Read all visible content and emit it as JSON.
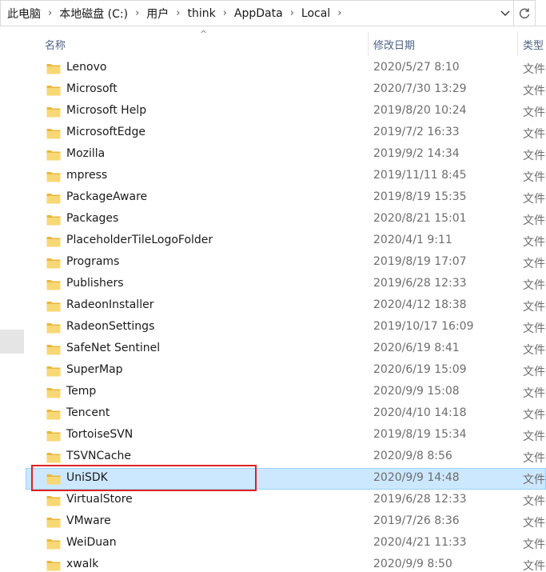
{
  "address_bar": {
    "crumbs": [
      "此电脑",
      "本地磁盘 (C:)",
      "用户",
      "think",
      "AppData",
      "Local"
    ],
    "separator": "›",
    "dropdown_icon": "chevron-down-icon",
    "refresh_icon": "refresh-icon"
  },
  "columns": {
    "name": "名称",
    "date_modified": "修改日期",
    "type": "类型",
    "sort_indicator": "^"
  },
  "rows": [
    {
      "name": "Lenovo",
      "date": "2020/5/27 8:10",
      "type": "文件"
    },
    {
      "name": "Microsoft",
      "date": "2020/7/30 13:29",
      "type": "文件"
    },
    {
      "name": "Microsoft Help",
      "date": "2019/8/20 10:24",
      "type": "文件"
    },
    {
      "name": "MicrosoftEdge",
      "date": "2019/7/2 16:33",
      "type": "文件"
    },
    {
      "name": "Mozilla",
      "date": "2019/9/2 14:34",
      "type": "文件"
    },
    {
      "name": "mpress",
      "date": "2019/11/11 8:45",
      "type": "文件"
    },
    {
      "name": "PackageAware",
      "date": "2019/8/19 15:35",
      "type": "文件"
    },
    {
      "name": "Packages",
      "date": "2020/8/21 15:01",
      "type": "文件"
    },
    {
      "name": "PlaceholderTileLogoFolder",
      "date": "2020/4/1 9:11",
      "type": "文件"
    },
    {
      "name": "Programs",
      "date": "2019/8/19 17:07",
      "type": "文件"
    },
    {
      "name": "Publishers",
      "date": "2019/6/28 12:33",
      "type": "文件"
    },
    {
      "name": "RadeonInstaller",
      "date": "2020/4/12 18:38",
      "type": "文件"
    },
    {
      "name": "RadeonSettings",
      "date": "2019/10/17 16:09",
      "type": "文件"
    },
    {
      "name": "SafeNet Sentinel",
      "date": "2020/6/19 8:41",
      "type": "文件"
    },
    {
      "name": "SuperMap",
      "date": "2020/6/19 15:09",
      "type": "文件"
    },
    {
      "name": "Temp",
      "date": "2020/9/9 15:08",
      "type": "文件"
    },
    {
      "name": "Tencent",
      "date": "2020/4/10 14:18",
      "type": "文件"
    },
    {
      "name": "TortoiseSVN",
      "date": "2019/8/19 15:34",
      "type": "文件"
    },
    {
      "name": "TSVNCache",
      "date": "2020/9/8 8:56",
      "type": "文件"
    },
    {
      "name": "UniSDK",
      "date": "2020/9/9 14:48",
      "type": "文件",
      "selected": true
    },
    {
      "name": "VirtualStore",
      "date": "2019/6/28 12:33",
      "type": "文件"
    },
    {
      "name": "VMware",
      "date": "2019/7/26 8:36",
      "type": "文件"
    },
    {
      "name": "WeiDuan",
      "date": "2020/4/21 11:33",
      "type": "文件"
    },
    {
      "name": "xwalk",
      "date": "2020/9/9 8:50",
      "type": "文件"
    }
  ],
  "colors": {
    "selection_bg": "#cce8ff",
    "selection_border": "#99d1ff",
    "annotation_red": "#e02020",
    "folder_yellow": "#f8d775",
    "header_text": "#4d6082",
    "date_text": "#6d6d6d"
  }
}
